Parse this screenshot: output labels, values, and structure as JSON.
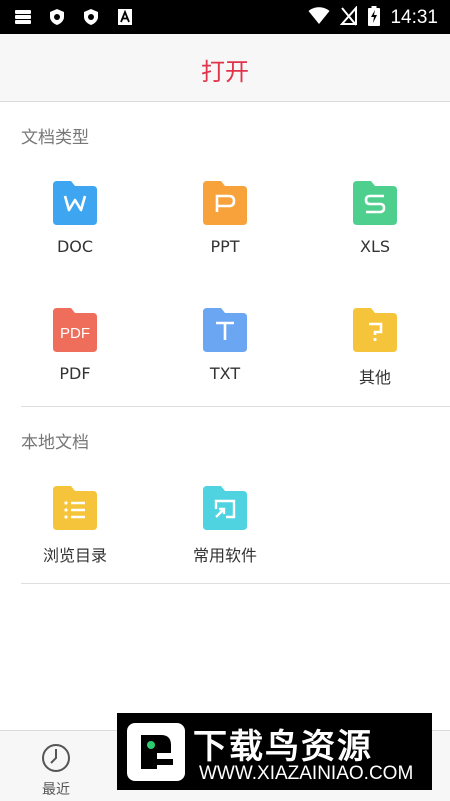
{
  "status_bar": {
    "time": "14:31"
  },
  "title": "打开",
  "section_doc_types": {
    "title": "文档类型",
    "items": [
      {
        "label": "DOC",
        "icon": "doc-folder-icon",
        "color": "#3ea6f0",
        "glyph": "W"
      },
      {
        "label": "PPT",
        "icon": "ppt-folder-icon",
        "color": "#f7a23b",
        "glyph": "P"
      },
      {
        "label": "XLS",
        "icon": "xls-folder-icon",
        "color": "#4fcf8e",
        "glyph": "S"
      },
      {
        "label": "PDF",
        "icon": "pdf-folder-icon",
        "color": "#ef6e5b",
        "glyph": "PDF"
      },
      {
        "label": "TXT",
        "icon": "txt-folder-icon",
        "color": "#6ba6f3",
        "glyph": "T"
      },
      {
        "label": "其他",
        "icon": "other-folder-icon",
        "color": "#f6c43a",
        "glyph": "?"
      }
    ]
  },
  "section_local": {
    "title": "本地文档",
    "items": [
      {
        "label": "浏览目录",
        "icon": "browse-folder-icon",
        "color": "#f6c43a"
      },
      {
        "label": "常用软件",
        "icon": "apps-folder-icon",
        "color": "#4fd3e0"
      }
    ]
  },
  "bottom_nav": {
    "items": [
      {
        "label": "最近",
        "icon": "clock-icon",
        "active": false
      }
    ]
  },
  "watermark": {
    "title": "下载鸟资源",
    "url": "WWW.XIAZAINIAO.COM"
  },
  "colors": {
    "accent": "#e0344c",
    "divider": "#dedede"
  }
}
